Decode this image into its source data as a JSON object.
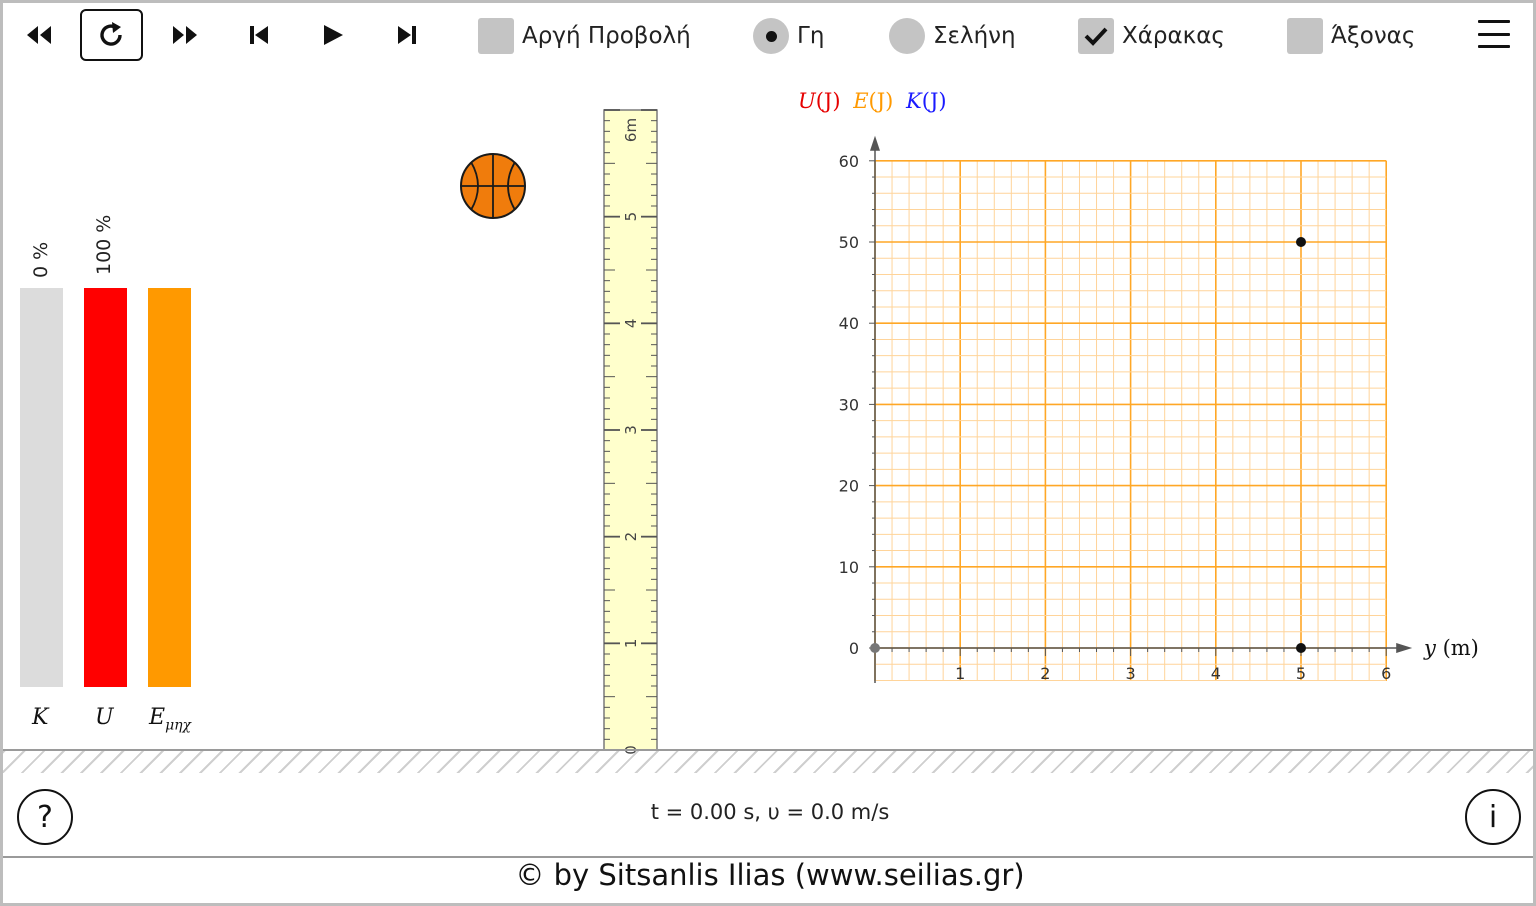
{
  "toolbar": {
    "buttons": [
      {
        "name": "rewind",
        "icon": "rewind-icon"
      },
      {
        "name": "restart",
        "icon": "restart-icon",
        "active": true
      },
      {
        "name": "fast-forward",
        "icon": "fast-forward-icon"
      },
      {
        "name": "step-back",
        "icon": "step-back-icon"
      },
      {
        "name": "play",
        "icon": "play-icon"
      },
      {
        "name": "step-forward",
        "icon": "step-forward-icon"
      }
    ],
    "slow_motion": {
      "label": "Αργή Προβολή",
      "checked": false
    },
    "earth": {
      "label": "Γη",
      "selected": true
    },
    "moon": {
      "label": "Σελήνη",
      "selected": false
    },
    "ruler": {
      "label": "Χάρακας",
      "checked": true
    },
    "axes": {
      "label": "Άξονας",
      "checked": false
    },
    "menu_icon": "hamburger-menu-icon"
  },
  "energy_bars": {
    "kinetic": {
      "label": "K",
      "percent": "0 %",
      "color": "#dcdcdc"
    },
    "potential": {
      "label": "U",
      "percent": "100 %",
      "color": "#ff0000"
    },
    "mechanical": {
      "label": "E",
      "sub": "μηχ",
      "color": "#ff9900"
    }
  },
  "ball": {
    "icon": "basketball-icon",
    "color": "#f07c0c"
  },
  "ruler": {
    "unit": "m",
    "ticks": [
      "0",
      "1",
      "2",
      "3",
      "4",
      "5",
      "6"
    ],
    "top_label": "6m"
  },
  "chart_data": {
    "type": "scatter",
    "legend": [
      {
        "sym": "U",
        "unit": "(J)",
        "color": "#e60000"
      },
      {
        "sym": "E",
        "unit": "(J)",
        "color": "#ff9900"
      },
      {
        "sym": "K",
        "unit": "(J)",
        "color": "#1a1aff"
      }
    ],
    "xlabel": "y (m)",
    "xlabel_sym": "y",
    "xlabel_unit": "(m)",
    "xlim": [
      0,
      6
    ],
    "ylim": [
      0,
      60
    ],
    "x_ticks": [
      "1",
      "2",
      "3",
      "4",
      "5",
      "6"
    ],
    "y_ticks": [
      "0",
      "10",
      "20",
      "30",
      "40",
      "50",
      "60"
    ],
    "grid": true,
    "points": [
      {
        "x": 5,
        "y": 50
      },
      {
        "x": 5,
        "y": 0
      }
    ]
  },
  "status": {
    "text": "t = 0.00 s, υ = 0.0 m/s"
  },
  "help_button": {
    "label": "?"
  },
  "info_button": {
    "label": "i"
  },
  "footer": {
    "copyright": "© by Sitsanlis Ilias (www.seilias.gr)"
  }
}
